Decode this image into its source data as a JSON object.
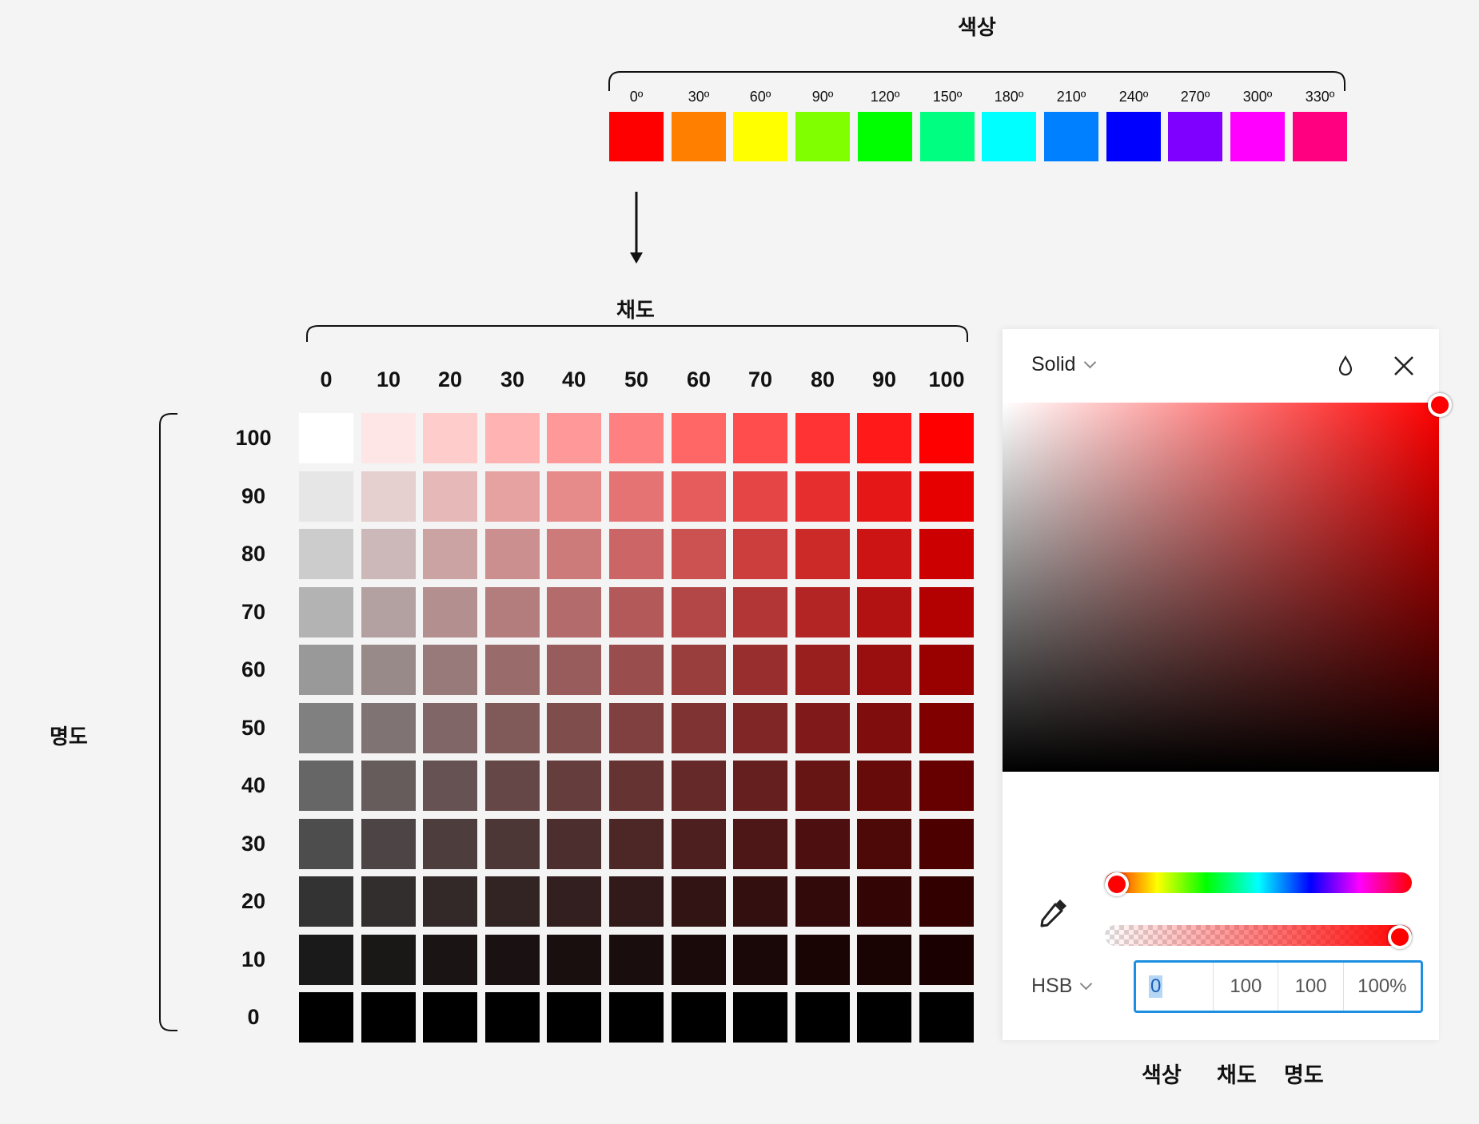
{
  "hue_section": {
    "title": "색상",
    "hues": [
      {
        "label": "0º",
        "color": "#ff0000"
      },
      {
        "label": "30º",
        "color": "#ff8000"
      },
      {
        "label": "60º",
        "color": "#ffff00"
      },
      {
        "label": "90º",
        "color": "#80ff00"
      },
      {
        "label": "120º",
        "color": "#00ff00"
      },
      {
        "label": "150º",
        "color": "#00ff80"
      },
      {
        "label": "180º",
        "color": "#00ffff"
      },
      {
        "label": "210º",
        "color": "#0080ff"
      },
      {
        "label": "240º",
        "color": "#0000ff"
      },
      {
        "label": "270º",
        "color": "#8000ff"
      },
      {
        "label": "300º",
        "color": "#ff00ff"
      },
      {
        "label": "330º",
        "color": "#ff0080"
      }
    ]
  },
  "grid": {
    "saturation_title": "채도",
    "brightness_title": "명도",
    "saturation_labels": [
      "0",
      "10",
      "20",
      "30",
      "40",
      "50",
      "60",
      "70",
      "80",
      "90",
      "100"
    ],
    "brightness_labels": [
      "100",
      "90",
      "80",
      "70",
      "60",
      "50",
      "40",
      "30",
      "20",
      "10",
      "0"
    ],
    "saturation_values": [
      0,
      10,
      20,
      30,
      40,
      50,
      60,
      70,
      80,
      90,
      100
    ],
    "brightness_values": [
      100,
      90,
      80,
      70,
      60,
      50,
      40,
      30,
      20,
      10,
      0
    ],
    "hue": 0
  },
  "picker": {
    "fill_mode": "Solid",
    "color_model": "HSB",
    "hue": "0",
    "saturation": "100",
    "brightness": "100",
    "opacity": "100%",
    "hue_value": 0,
    "opacity_value": 1.0,
    "selected_color": "#ff0000",
    "icons": [
      "droplet-icon",
      "close-icon",
      "eyedropper-icon"
    ]
  },
  "footer_labels": {
    "hue": "색상",
    "saturation": "채도",
    "brightness": "명도"
  }
}
